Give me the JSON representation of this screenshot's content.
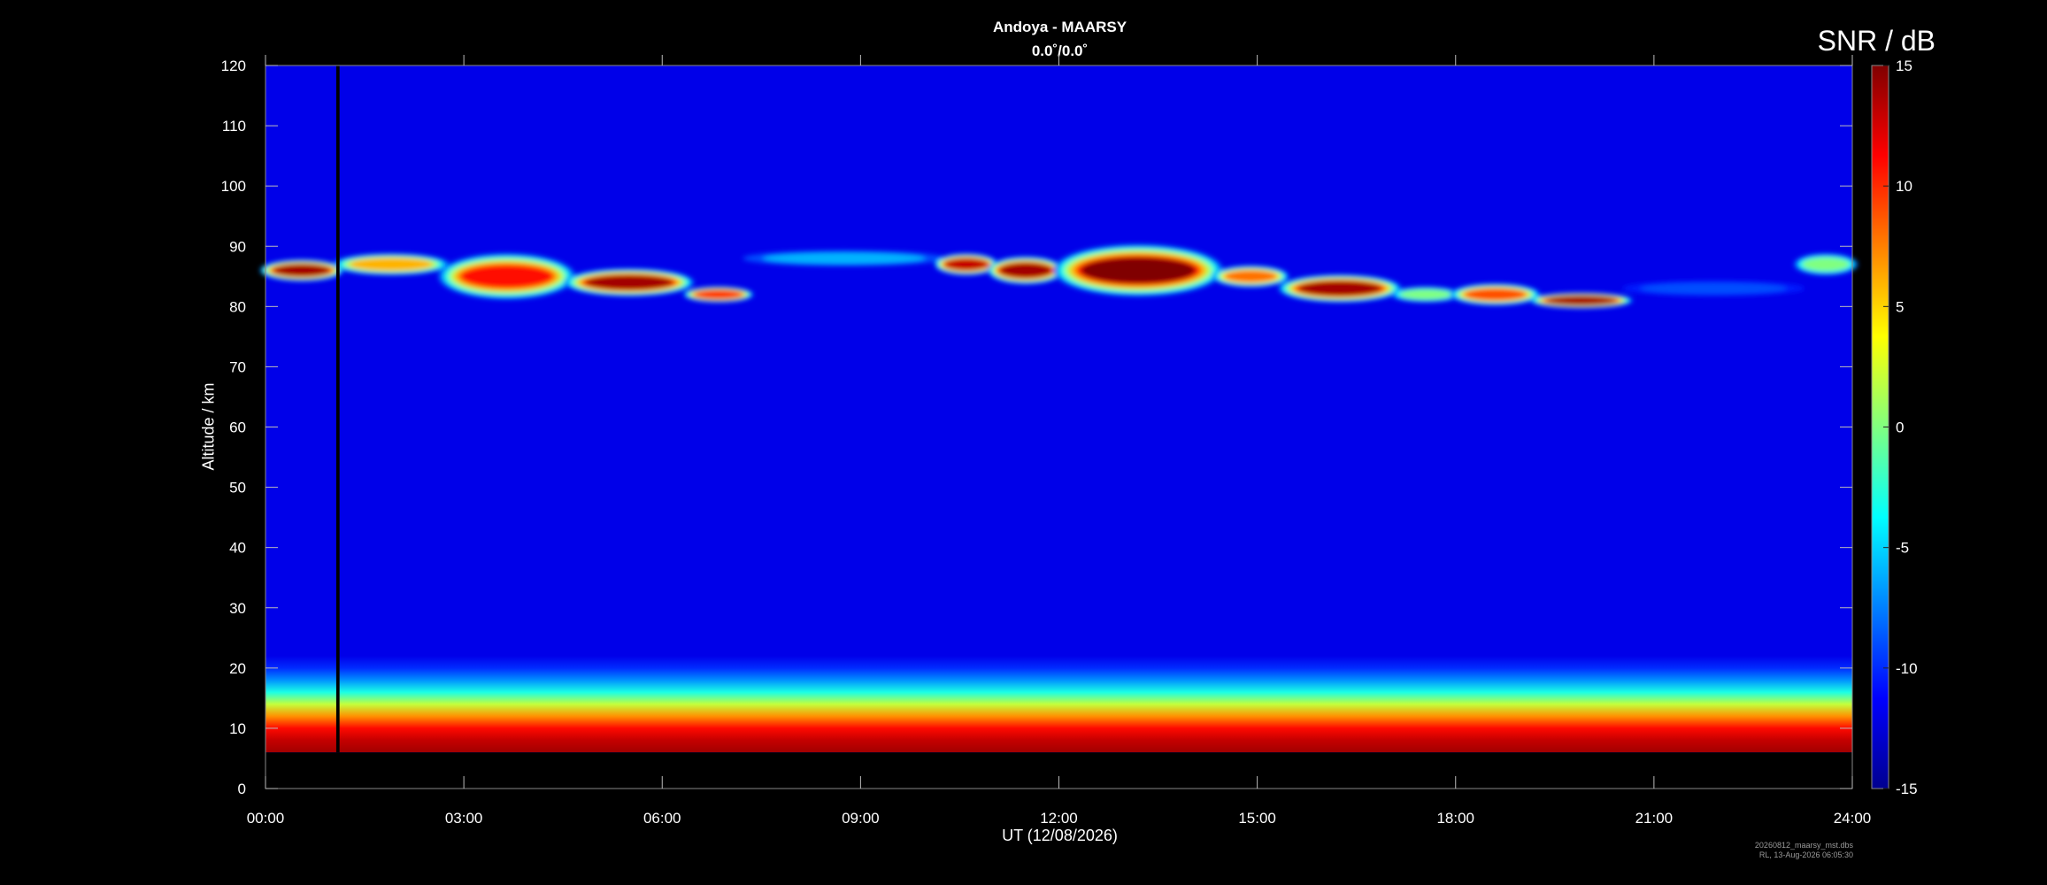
{
  "chart_data": {
    "type": "heatmap",
    "title": "Andoya - MAARSY",
    "subtitle": "0.0˚/0.0˚",
    "xlabel": "UT (12/08/2026)",
    "ylabel": "Altitude / km",
    "colorbar_label": "SNR / dB",
    "xlim": [
      0,
      24
    ],
    "ylim": [
      0,
      120
    ],
    "zlim": [
      -15,
      15
    ],
    "x_ticks": [
      "00:00",
      "03:00",
      "06:00",
      "09:00",
      "12:00",
      "15:00",
      "18:00",
      "21:00",
      "24:00"
    ],
    "y_ticks": [
      "0",
      "10",
      "20",
      "30",
      "40",
      "50",
      "60",
      "70",
      "80",
      "90",
      "100",
      "110",
      "120"
    ],
    "colorbar_ticks": [
      "15",
      "10",
      "5",
      "0",
      "-5",
      "-10",
      "-15"
    ],
    "colormap": [
      "#00008f",
      "#0000ff",
      "#0080ff",
      "#00ffff",
      "#80ff80",
      "#ffff00",
      "#ff8000",
      "#ff0000",
      "#800000"
    ],
    "background_snr_db": -12,
    "data_gap": {
      "x": [
        1.07,
        1.12
      ],
      "y": [
        6,
        120
      ]
    },
    "data_lower_limit_km": 6,
    "echo_layers": [
      {
        "x_start": 0.0,
        "x_end": 1.1,
        "center_km": 86,
        "thickness_km": 3,
        "peak_snr_db": 14
      },
      {
        "x_start": 1.1,
        "x_end": 2.7,
        "center_km": 87,
        "thickness_km": 3,
        "peak_snr_db": 6
      },
      {
        "x_start": 2.7,
        "x_end": 4.6,
        "center_km": 85,
        "thickness_km": 7,
        "peak_snr_db": 11
      },
      {
        "x_start": 4.6,
        "x_end": 6.4,
        "center_km": 84,
        "thickness_km": 4,
        "peak_snr_db": 14
      },
      {
        "x_start": 6.4,
        "x_end": 7.3,
        "center_km": 82,
        "thickness_km": 2,
        "peak_snr_db": 10
      },
      {
        "x_start": 7.3,
        "x_end": 10.2,
        "center_km": 88,
        "thickness_km": 2,
        "peak_snr_db": -6
      },
      {
        "x_start": 10.2,
        "x_end": 11.0,
        "center_km": 87,
        "thickness_km": 3,
        "peak_snr_db": 13
      },
      {
        "x_start": 11.0,
        "x_end": 12.0,
        "center_km": 86,
        "thickness_km": 4,
        "peak_snr_db": 14
      },
      {
        "x_start": 12.0,
        "x_end": 14.4,
        "center_km": 86,
        "thickness_km": 8,
        "peak_snr_db": 15
      },
      {
        "x_start": 14.4,
        "x_end": 15.4,
        "center_km": 85,
        "thickness_km": 3,
        "peak_snr_db": 8
      },
      {
        "x_start": 15.4,
        "x_end": 17.1,
        "center_km": 83,
        "thickness_km": 4,
        "peak_snr_db": 14
      },
      {
        "x_start": 17.1,
        "x_end": 18.0,
        "center_km": 82,
        "thickness_km": 2,
        "peak_snr_db": 0
      },
      {
        "x_start": 18.0,
        "x_end": 19.2,
        "center_km": 82,
        "thickness_km": 3,
        "peak_snr_db": 9
      },
      {
        "x_start": 19.2,
        "x_end": 20.6,
        "center_km": 81,
        "thickness_km": 2,
        "peak_snr_db": 14
      },
      {
        "x_start": 20.6,
        "x_end": 23.2,
        "center_km": 83,
        "thickness_km": 2,
        "peak_snr_db": -9
      },
      {
        "x_start": 23.2,
        "x_end": 24.0,
        "center_km": 87,
        "thickness_km": 3,
        "peak_snr_db": 0
      }
    ],
    "lower_atmosphere_profile": [
      {
        "km": 6,
        "snr_db": 14
      },
      {
        "km": 8,
        "snr_db": 13
      },
      {
        "km": 10,
        "snr_db": 11
      },
      {
        "km": 12,
        "snr_db": 7
      },
      {
        "km": 14,
        "snr_db": 2
      },
      {
        "km": 16,
        "snr_db": -3
      },
      {
        "km": 18,
        "snr_db": -7
      },
      {
        "km": 20,
        "snr_db": -10
      },
      {
        "km": 22,
        "snr_db": -12
      }
    ],
    "footer": [
      "20260812_maarsy_mst.dbs",
      "RL, 13-Aug-2026 06:05:30"
    ]
  }
}
